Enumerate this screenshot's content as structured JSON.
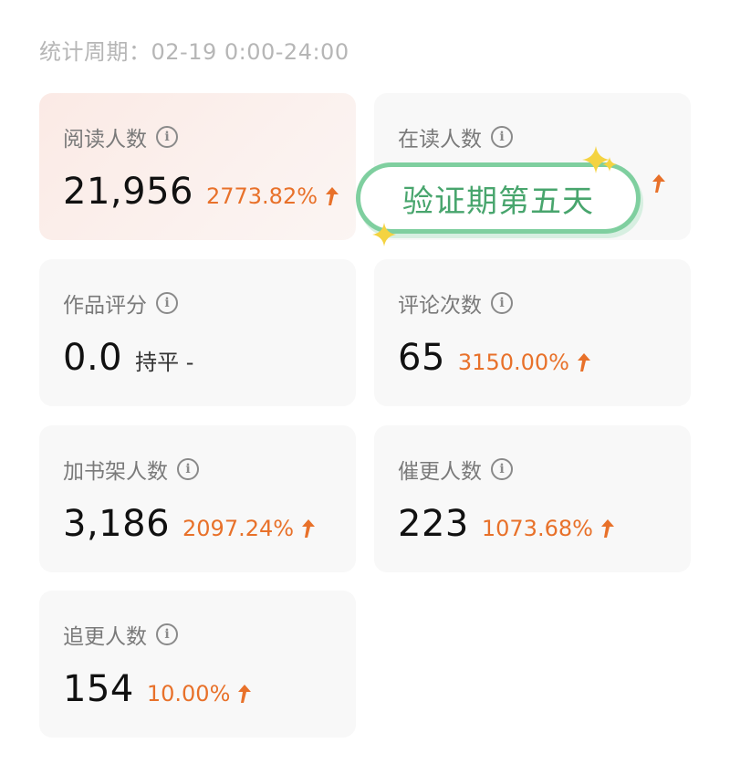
{
  "period": "统计周期：02-19 0:00-24:00",
  "info_glyph": "i",
  "arrow_icon": "arrow-up-icon",
  "accent_color": "#e8712a",
  "cards": [
    {
      "label": "阅读人数",
      "value": "21,956",
      "change": "2773.82%",
      "trend": "up"
    },
    {
      "label": "在读人数",
      "value": "",
      "change": "",
      "trend": "up"
    },
    {
      "label": "作品评分",
      "value": "0.0",
      "change": "持平 -",
      "trend": "flat"
    },
    {
      "label": "评论次数",
      "value": "65",
      "change": "3150.00%",
      "trend": "up"
    },
    {
      "label": "加书架人数",
      "value": "3,186",
      "change": "2097.24%",
      "trend": "up"
    },
    {
      "label": "催更人数",
      "value": "223",
      "change": "1073.68%",
      "trend": "up"
    },
    {
      "label": "追更人数",
      "value": "154",
      "change": "10.00%",
      "trend": "up"
    }
  ],
  "stamp": {
    "text": "验证期第五天",
    "color": "#48a56d"
  }
}
